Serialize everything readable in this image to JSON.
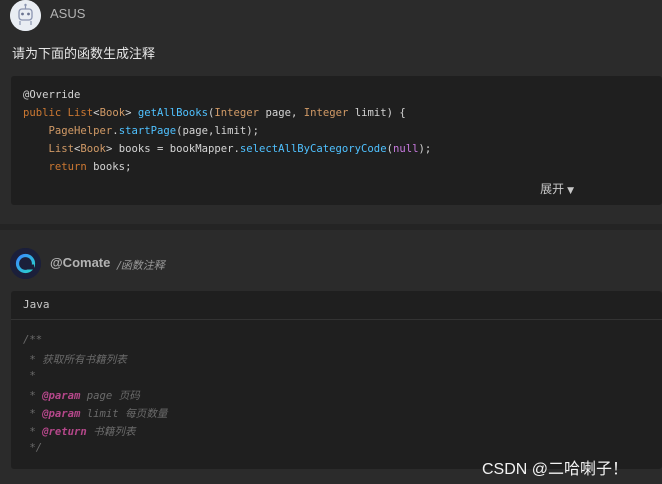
{
  "user": {
    "name": "ASUS",
    "prompt": "请为下面的函数生成注释"
  },
  "user_code": {
    "lines": [
      "@Override",
      "public List<Book> getAllBooks(Integer page, Integer limit) {",
      "    PageHelper.startPage(page,limit);",
      "    List<Book> books = bookMapper.selectAllByCategoryCode(null);",
      "    return books;"
    ],
    "tokens": {
      "l1_a": "public ",
      "l1_b": "List",
      "l1_c": "<",
      "l1_d": "Book",
      "l1_e": "> ",
      "l1_f": "getAllBooks",
      "l1_g": "(",
      "l1_h": "Integer",
      "l1_i": " page, ",
      "l1_j": "Integer",
      "l1_k": " limit) {",
      "l2_a": "    ",
      "l2_b": "PageHelper",
      "l2_c": ".",
      "l2_d": "startPage",
      "l2_e": "(page,limit);",
      "l3_a": "    ",
      "l3_b": "List",
      "l3_c": "<",
      "l3_d": "Book",
      "l3_e": "> books = bookMapper.",
      "l3_f": "selectAllByCategoryCode",
      "l3_g": "(",
      "l3_h": "null",
      "l3_i": ");",
      "l4_a": "    ",
      "l4_b": "return",
      "l4_c": " books;"
    },
    "expand_label": "展开",
    "expand_icon": "▼"
  },
  "bot": {
    "name": "@Comate",
    "command": "/函数注释"
  },
  "bot_code": {
    "language": "Java",
    "lines": [
      "/**",
      " * 获取所有书籍列表",
      " *",
      " * @param page 页码",
      " * @param limit 每页数量",
      " * @return 书籍列表",
      " */"
    ],
    "tokens": {
      "l4_pre": " * ",
      "l4_tag": "@param",
      "l4_rest": " page 页码",
      "l5_pre": " * ",
      "l5_tag": "@param",
      "l5_rest": " limit 每页数量",
      "l6_pre": " * ",
      "l6_tag": "@return",
      "l6_rest": " 书籍列表"
    }
  },
  "watermark": "CSDN @二哈喇子！",
  "colors": {
    "background": "#2b2b2b",
    "code_bg": "#1f1f1f",
    "keyword": "#cc7832",
    "function": "#4fc1ff",
    "type": "#d19a66",
    "null_literal": "#c678dd",
    "comment": "#6b6b6b",
    "javadoc_tag": "#b5478a"
  },
  "icons": {
    "user_avatar": "robot-avatar-icon",
    "bot_avatar": "comate-logo-icon"
  }
}
